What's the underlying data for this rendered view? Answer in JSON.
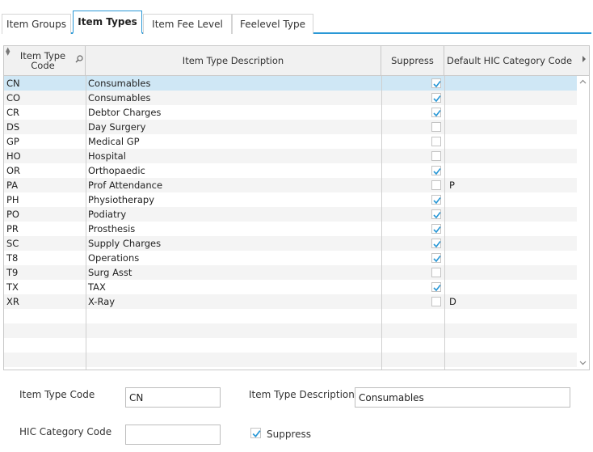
{
  "tabs": [
    {
      "label": "Item Groups",
      "active": false
    },
    {
      "label": "Item Types",
      "active": true
    },
    {
      "label": "Item Fee Level",
      "active": false
    },
    {
      "label": "Feelevel Type",
      "active": false
    }
  ],
  "grid": {
    "columns": {
      "code": "Item Type Code",
      "description": "Item Type Description",
      "suppress": "Suppress",
      "hic": "Default HIC Category Code"
    },
    "rows": [
      {
        "code": "CN",
        "description": "Consumables",
        "suppress": true,
        "hic": ""
      },
      {
        "code": "CO",
        "description": "Consumables",
        "suppress": true,
        "hic": ""
      },
      {
        "code": "CR",
        "description": "Debtor Charges",
        "suppress": true,
        "hic": ""
      },
      {
        "code": "DS",
        "description": "Day Surgery",
        "suppress": false,
        "hic": ""
      },
      {
        "code": "GP",
        "description": "Medical GP",
        "suppress": false,
        "hic": ""
      },
      {
        "code": "HO",
        "description": "Hospital",
        "suppress": false,
        "hic": ""
      },
      {
        "code": "OR",
        "description": "Orthopaedic",
        "suppress": true,
        "hic": ""
      },
      {
        "code": "PA",
        "description": "Prof Attendance",
        "suppress": false,
        "hic": "P"
      },
      {
        "code": "PH",
        "description": "Physiotherapy",
        "suppress": true,
        "hic": ""
      },
      {
        "code": "PO",
        "description": "Podiatry",
        "suppress": true,
        "hic": ""
      },
      {
        "code": "PR",
        "description": "Prosthesis",
        "suppress": true,
        "hic": ""
      },
      {
        "code": "SC",
        "description": "Supply Charges",
        "suppress": true,
        "hic": ""
      },
      {
        "code": "T8",
        "description": "Operations",
        "suppress": true,
        "hic": ""
      },
      {
        "code": "T9",
        "description": "Surg Asst",
        "suppress": false,
        "hic": ""
      },
      {
        "code": "TX",
        "description": "TAX",
        "suppress": true,
        "hic": ""
      },
      {
        "code": "XR",
        "description": "X-Ray",
        "suppress": false,
        "hic": "D"
      }
    ],
    "selected_index": 0,
    "empty_rows": 4
  },
  "form": {
    "item_type_code_label": "Item Type Code",
    "item_type_code_value": "CN",
    "item_type_description_label": "Item Type Description",
    "item_type_description_value": "Consumables",
    "hic_category_code_label": "HIC Category Code",
    "hic_category_code_value": "",
    "suppress_label": "Suppress",
    "suppress_checked": true
  },
  "colors": {
    "accent": "#2a98d6",
    "selected_row": "#cfe7f5",
    "check": "#2a98d6"
  },
  "icons": {
    "sort": "sort-arrows-icon",
    "search": "search-icon",
    "scroll_right": "chevron-right-icon",
    "scroll_up": "chevron-up-icon",
    "scroll_down": "chevron-down-icon",
    "check": "checkmark-icon"
  }
}
